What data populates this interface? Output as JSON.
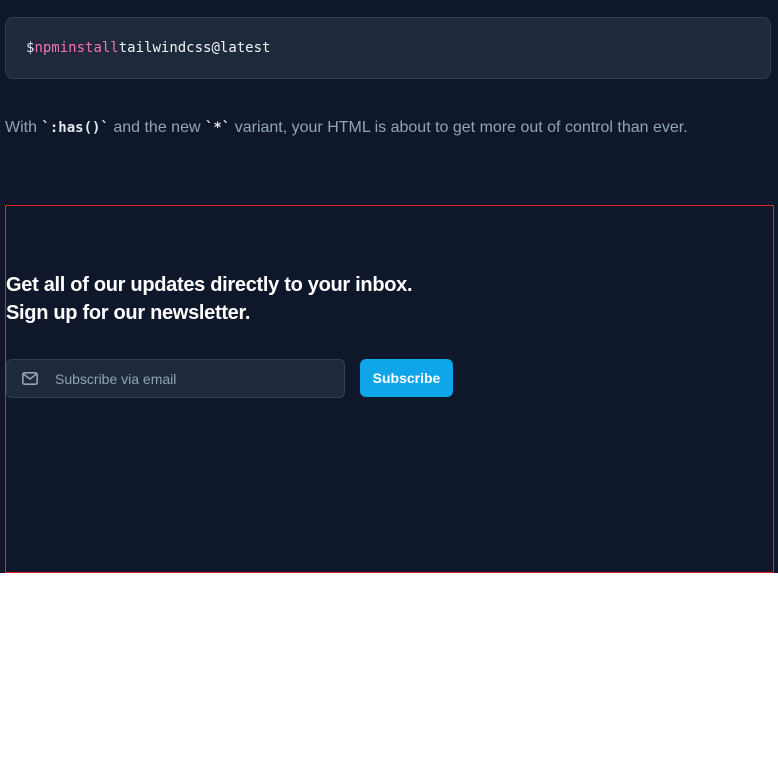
{
  "install_command": {
    "prompt": "$",
    "command": "npm",
    "subcommand": "install",
    "package": "tailwindcss@latest"
  },
  "intro": {
    "text_1": "With ",
    "code_1": "`:has()`",
    "text_2": " and the new ",
    "code_2": "`*`",
    "text_3": " variant, your HTML is about to get more out of control than ever."
  },
  "newsletter": {
    "headline_line_1": "Get all of our updates directly to your inbox.",
    "headline_line_2": "Sign up for our newsletter.",
    "email_placeholder": "Subscribe via email",
    "email_icon": "mail-icon",
    "subscribe_label": "Subscribe"
  },
  "colors": {
    "background": "#0f172a",
    "code_background": "#1e293b",
    "accent": "#0ea5e9",
    "command_pink": "#f472b6",
    "muted_text": "#94a3b8",
    "debug_outline": "#dc2626"
  }
}
